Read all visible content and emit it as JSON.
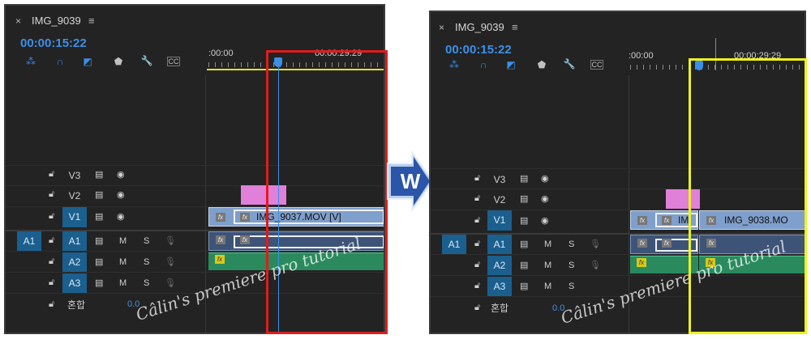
{
  "left": {
    "tab_close": "×",
    "sequence_name": "IMG_9039",
    "tab_menu": "≡",
    "timecode": "00:00:15:22",
    "ruler_start": ":00:00",
    "ruler_end": "00:00:29:29",
    "tracks": {
      "v3": "V3",
      "v2": "V2",
      "v1": "V1",
      "a1_source": "A1",
      "a1": "A1",
      "a2": "A2",
      "a3": "A3",
      "m": "M",
      "s": "S"
    },
    "mix_label": "혼합",
    "mix_value": "0.0",
    "clip_label": "IMG_9037.MOV [V]",
    "watermark": "Câlin's premiere pro tutorial"
  },
  "right": {
    "tab_close": "×",
    "sequence_name": "IMG_9039",
    "tab_menu": "≡",
    "timecode": "00:00:15:22",
    "ruler_start": ":00:00",
    "ruler_end": "00:00:29:29",
    "tracks": {
      "v3": "V3",
      "v2": "V2",
      "v1": "V1",
      "a1_source": "A1",
      "a1": "A1",
      "a2": "A2",
      "a3": "A3",
      "m": "M",
      "s": "S"
    },
    "mix_label": "혼합",
    "mix_value": "0.0",
    "clip_label_a": "IM",
    "clip_label_b": "IMG_9038.MO",
    "watermark": "Câlin's premiere pro tutorial"
  },
  "arrow_letter": "W",
  "fx": "fx",
  "icons": {
    "lock": "lock-icon",
    "film": "film-icon",
    "eye": "eye-icon",
    "mic": "mic-icon",
    "snap": "snap-icon",
    "magnet": "magnet-icon",
    "linked": "linked-selection-icon",
    "marker": "marker-icon",
    "wrench": "wrench-icon",
    "captions": "captions-icon"
  },
  "colors": {
    "accent_blue": "#3b8fe6",
    "highlight_red": "#e21b1b",
    "highlight_yellow": "#eef21a",
    "video_clip": "#7f9fcc",
    "audio_clip": "#3d5478",
    "audio_clip_2": "#2a8a5e",
    "pink_clip": "#e080d8"
  }
}
